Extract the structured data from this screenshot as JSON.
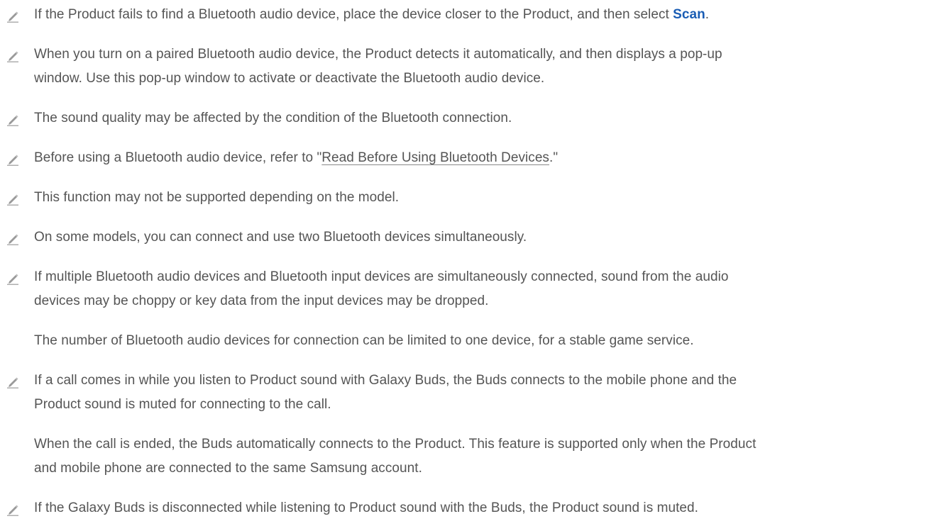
{
  "icons": {
    "note_icon": "pencil-icon",
    "icon_color": "#8a8a8a"
  },
  "colors": {
    "text": "#555555",
    "link_blue": "#1a5db4"
  },
  "notes": [
    {
      "pre": "If the Product fails to find a Bluetooth audio device, place the device closer to the Product, and then select ",
      "link": "Scan",
      "post": "."
    },
    {
      "line1": "When you turn on a paired Bluetooth audio device, the Product detects it automatically, and then displays a pop-up",
      "line2": "window. Use this pop-up window to activate or deactivate the Bluetooth audio device."
    },
    {
      "line1": "The sound quality may be affected by the condition of the Bluetooth connection."
    },
    {
      "pre": "Before using a Bluetooth audio device, refer to \"",
      "link": "Read Before Using Bluetooth Devices",
      "post": ".\""
    },
    {
      "line1": "This function may not be supported depending on the model."
    },
    {
      "line1": "On some models, you can connect and use two Bluetooth devices simultaneously."
    },
    {
      "line1": "If multiple Bluetooth audio devices and Bluetooth input devices are simultaneously connected, sound from the audio",
      "line2": "devices may be choppy or key data from the input devices may be dropped.",
      "extra1": "The number of Bluetooth audio devices for connection can be limited to one device, for a stable game service."
    },
    {
      "line1": "If a call comes in while you listen to Product sound with Galaxy Buds, the Buds connects to the mobile phone and the",
      "line2": "Product sound is muted for connecting to the call.",
      "extra1": "When the call is ended, the Buds automatically connects to the Product. This feature is supported only when the Product",
      "extra2": "and mobile phone are connected to the same Samsung account."
    },
    {
      "line1": "If the Galaxy Buds is disconnected while listening to Product sound with the Buds, the Product sound is muted."
    }
  ]
}
